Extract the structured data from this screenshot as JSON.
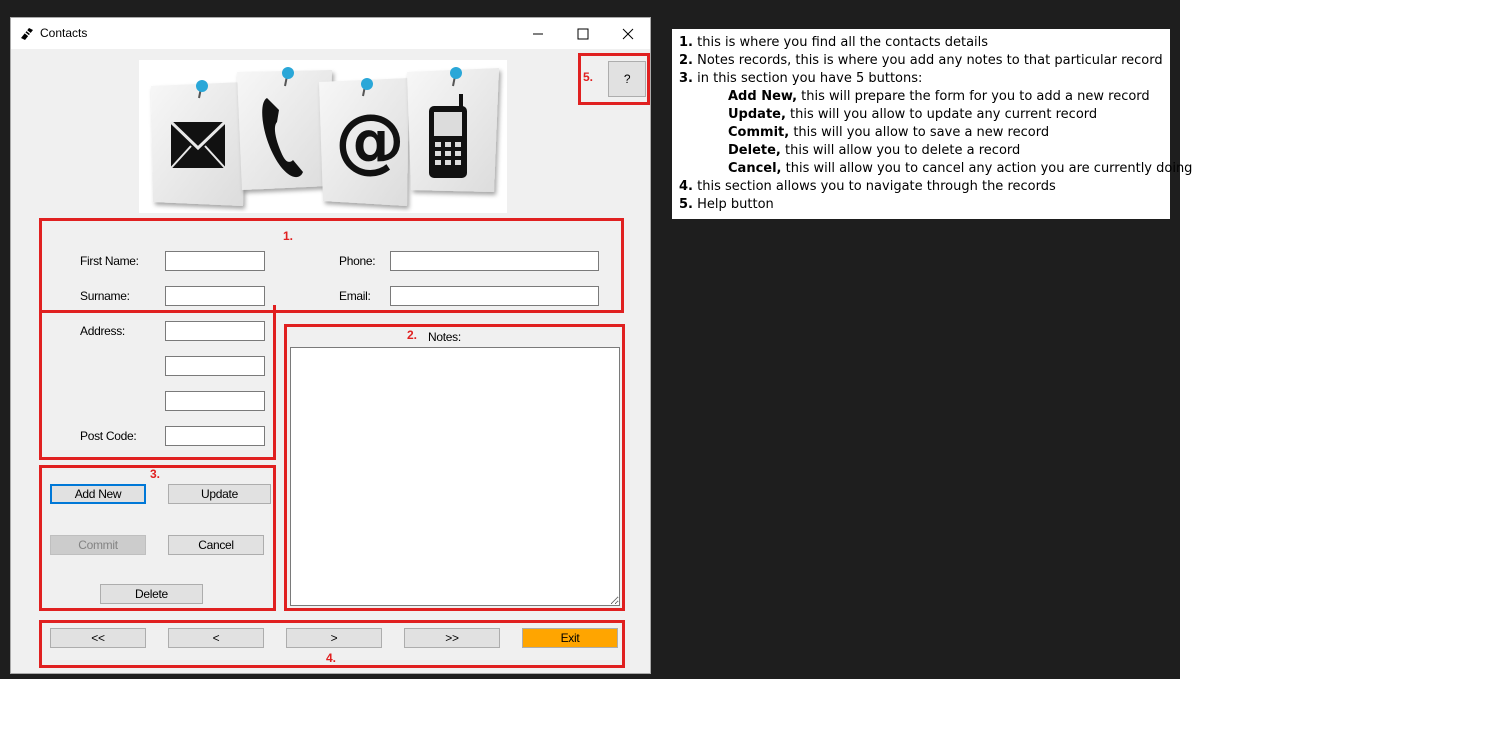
{
  "window": {
    "title": "Contacts",
    "icon": "contacts-app-icon",
    "controls": [
      "minimize-icon",
      "maximize-icon",
      "close-icon"
    ]
  },
  "form": {
    "labels": {
      "first_name": "First Name:",
      "surname": "Surname:",
      "address": "Address:",
      "post_code": "Post Code:",
      "phone": "Phone:",
      "email": "Email:",
      "notes": "Notes:"
    },
    "values": {
      "first_name": "",
      "surname": "",
      "address_1": "",
      "address_2": "",
      "address_3": "",
      "post_code": "",
      "phone": "",
      "email": "",
      "notes": ""
    }
  },
  "buttons": {
    "help": "?",
    "add_new": "Add New",
    "update": "Update",
    "commit": "Commit",
    "cancel": "Cancel",
    "delete": "Delete",
    "first": "<<",
    "prev": "<",
    "next": ">",
    "last": ">>",
    "exit": "Exit"
  },
  "annotations": {
    "section1": "1.",
    "section2": "2.",
    "section3": "3.",
    "section4": "4.",
    "section5": "5."
  },
  "help_text": {
    "l1_num": "1.",
    "l1_text": " this is where you find all the contacts details",
    "l2_num": "2.",
    "l2_text": " Notes records, this is where you add any notes to that particular record",
    "l3_num": "3.",
    "l3_text": " in this section you have 5 buttons:",
    "l4_bold": "Add New,",
    "l4_text": " this will prepare the form for you to add a new record",
    "l5_bold": "Update,",
    "l5_text": " this will you allow to update any current record",
    "l6_bold": "Commit,",
    "l6_text": " this will you allow to save a new record",
    "l7_bold": "Delete,",
    "l7_text": " this will allow you to delete a record",
    "l8_bold": "Cancel,",
    "l8_text": " this will allow you to cancel any action you are currently doing",
    "l9_num": "4.",
    "l9_text": " this section allows you to navigate through the records",
    "l10_num": "5.",
    "l10_text": " Help button"
  },
  "colors": {
    "annotation_red": "#e02020",
    "exit_button": "#ffa500",
    "focus_blue": "#0078d7",
    "pin_blue": "#2aa7d8"
  },
  "hero_icons": [
    "envelope-icon",
    "phone-icon",
    "at-sign-icon",
    "mobile-phone-icon"
  ]
}
